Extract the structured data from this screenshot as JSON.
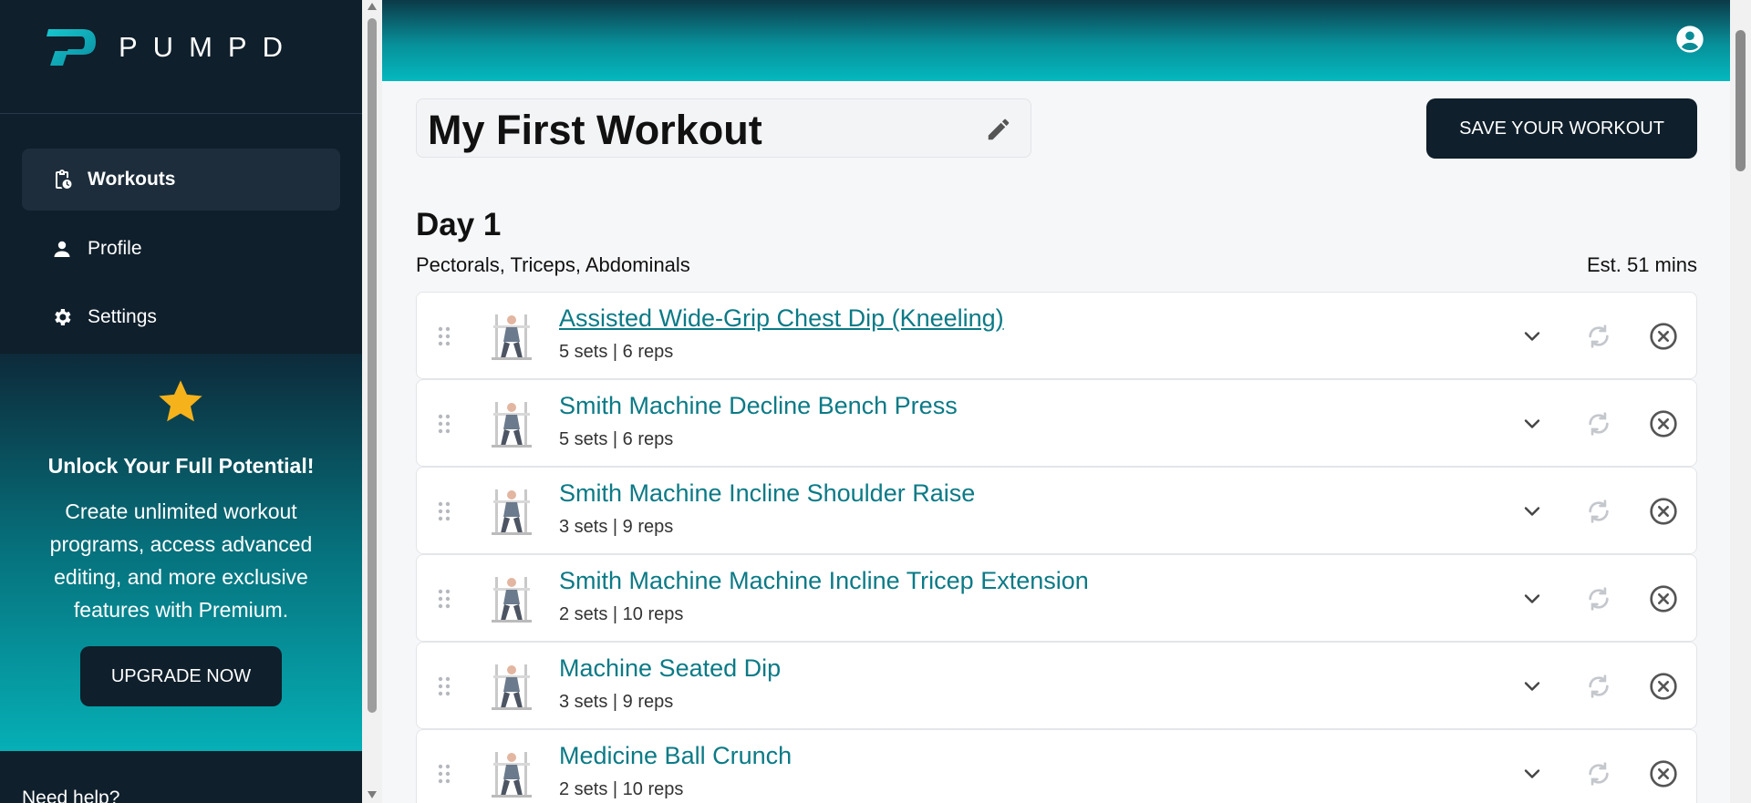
{
  "brand": {
    "name": "PUMPD"
  },
  "sidebar": {
    "items": [
      {
        "label": "Workouts",
        "icon": "clipboard-clock-icon",
        "active": true
      },
      {
        "label": "Profile",
        "icon": "person-icon",
        "active": false
      },
      {
        "label": "Settings",
        "icon": "gear-icon",
        "active": false
      }
    ],
    "promo": {
      "title": "Unlock Your Full Potential!",
      "body": "Create unlimited workout programs, access advanced editing, and more exclusive features with Premium.",
      "button": "UPGRADE NOW"
    },
    "help": "Need help?"
  },
  "workout": {
    "title": "My First Workout",
    "save_label": "SAVE YOUR WORKOUT"
  },
  "day": {
    "title": "Day 1",
    "muscles": "Pectorals, Triceps, Abdominals",
    "estimate": "Est. 51 mins",
    "exercises": [
      {
        "name": "Assisted Wide-Grip Chest Dip (Kneeling)",
        "meta": "5 sets | 6 reps"
      },
      {
        "name": "Smith Machine Decline Bench Press",
        "meta": "5 sets | 6 reps"
      },
      {
        "name": "Smith Machine Incline Shoulder Raise",
        "meta": "3 sets | 9 reps"
      },
      {
        "name": "Smith Machine Machine Incline Tricep Extension",
        "meta": "2 sets | 10 reps"
      },
      {
        "name": "Machine Seated Dip",
        "meta": "3 sets | 9 reps"
      },
      {
        "name": "Medicine Ball Crunch",
        "meta": "2 sets | 10 reps"
      }
    ]
  },
  "colors": {
    "accent": "#0b7a86",
    "dark": "#0f1f2b",
    "star": "#f6b21b"
  }
}
